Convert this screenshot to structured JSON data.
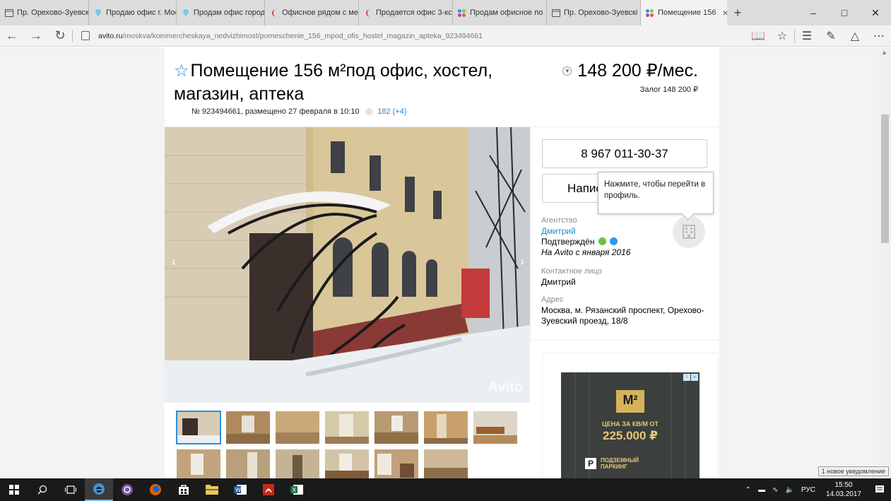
{
  "browser": {
    "tabs": [
      {
        "label": "Пр. Орехово-Зуевскі",
        "icon": "page-icon",
        "active": false
      },
      {
        "label": "Продаю офис г. Мос",
        "icon": "pin-icon",
        "active": false
      },
      {
        "label": "Продам офис город",
        "icon": "pin-icon",
        "active": false
      },
      {
        "label": "Офисное рядом с ме",
        "icon": "flag-icon",
        "active": false
      },
      {
        "label": "Продается офис 3-кс",
        "icon": "flag-icon",
        "active": false
      },
      {
        "label": "Продам офисное по",
        "icon": "avito-icon",
        "active": false
      },
      {
        "label": "Пр. Орехово-Зуевскі",
        "icon": "page-icon",
        "active": false
      },
      {
        "label": "Помещение 156",
        "icon": "avito-icon",
        "active": true
      }
    ],
    "url_host": "avito.ru",
    "url_path": "/moskva/kommercheskaya_nedvizhimost/pomeschenie_156_mpod_ofis_hostel_magazin_apteka_923494661"
  },
  "listing": {
    "title": "Помещение 156 м²под офис, хостел, магазин, аптека",
    "meta": "№ 923494661, размещено 27 февраля в 10:10",
    "views": "182 (+4)",
    "price": "148 200 ₽/мес.",
    "deposit": "Залог 148 200 ₽",
    "watermark": "Avito"
  },
  "contact": {
    "phone": "8 967 011-30-37",
    "write_label": "Написать сообщение",
    "tooltip": "Нажмите, чтобы перейти в профиль.",
    "agency_label": "Агентство",
    "agency_name": "Дмитрий",
    "confirmed": "Подтверждён",
    "since": "На Avito с января 2016",
    "contact_label": "Контактное лицо",
    "contact_name": "Дмитрий",
    "address_label": "Адрес",
    "address": "Москва, м. Рязанский проспект, Орехово-Зуевский проезд, 18/8"
  },
  "ad": {
    "logo": "M²",
    "line1": "ЦЕНА ЗА КВ/М ОТ",
    "line2": "225.000 ₽",
    "badge": "P",
    "line3": "ПОДЗЕМНЫЙ",
    "line4": "ПАРКИНГ"
  },
  "taskbar": {
    "lang": "РУС",
    "time": "15:50",
    "date": "14.03.2017",
    "notification": "1 новое уведомление"
  },
  "colors": {
    "accent": "#1e88d6",
    "tab_bar": "#dcdcdc",
    "taskbar": "#1a1a1a"
  }
}
